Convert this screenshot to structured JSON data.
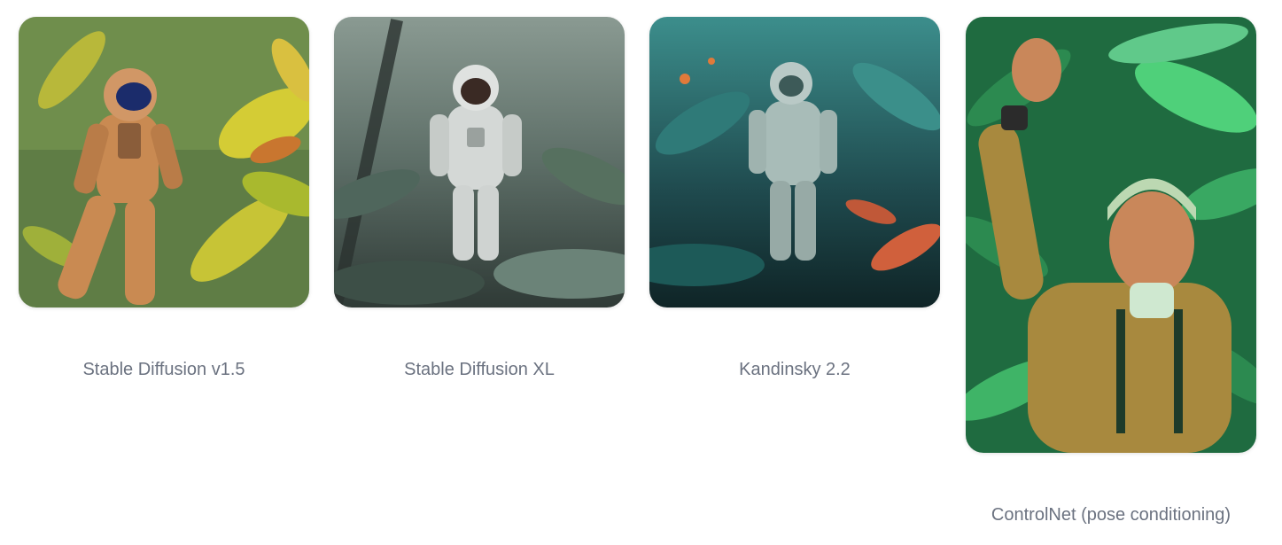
{
  "gallery": {
    "items": [
      {
        "caption": "Stable Diffusion v1.5",
        "image_subject": "astronaut-in-jungle-illustration",
        "palette": {
          "bg": "#6b8a4a",
          "leaf": "#c9c836",
          "suit": "#c98a52",
          "visor": "#1b2c6b"
        }
      },
      {
        "caption": "Stable Diffusion XL",
        "image_subject": "astronaut-in-misty-jungle-photo",
        "palette": {
          "bg": "#5c6d66",
          "leaf": "#8fa59a",
          "suit": "#d4d8d6",
          "visor": "#3a2a24"
        }
      },
      {
        "caption": "Kandinsky 2.2",
        "image_subject": "astronaut-in-teal-jungle",
        "palette": {
          "bg": "#1f4a4e",
          "leaf": "#2f7a78",
          "suit": "#b9c9c6",
          "accent": "#d0603c"
        }
      },
      {
        "caption": "ControlNet (pose conditioning)",
        "image_subject": "man-waving-in-jungle-illustration",
        "palette": {
          "bg": "#1f6b40",
          "leaf": "#4fd07a",
          "suit": "#a8893e",
          "skin": "#c9875a"
        }
      }
    ]
  }
}
